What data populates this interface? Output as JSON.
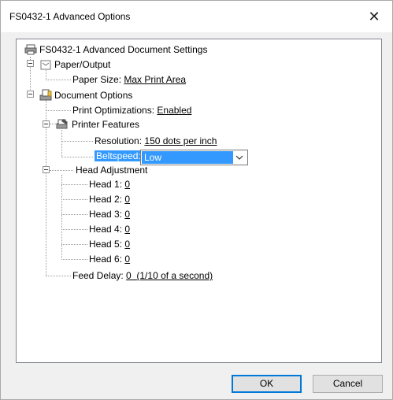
{
  "window": {
    "title": "FS0432-1 Advanced Options",
    "close_glyph": "✕"
  },
  "tree": {
    "root": "FS0432-1 Advanced Document Settings",
    "paper_output": "Paper/Output",
    "paper_size_label": "Paper Size:",
    "paper_size_value": "Max Print Area",
    "document_options": "Document Options",
    "print_opt_label": "Print Optimizations:",
    "print_opt_value": "Enabled",
    "printer_features": "Printer Features",
    "resolution_label": "Resolution:",
    "resolution_value": "150 dots per inch",
    "beltspeed_label": "Beltspeed:",
    "beltspeed_value": "Low",
    "head_adjustment": "Head Adjustment",
    "heads": [
      {
        "label": "Head 1:",
        "value": "0"
      },
      {
        "label": "Head 2:",
        "value": "0"
      },
      {
        "label": "Head 3:",
        "value": "0"
      },
      {
        "label": "Head 4:",
        "value": "0"
      },
      {
        "label": "Head 5:",
        "value": "0"
      },
      {
        "label": "Head 6:",
        "value": "0"
      }
    ],
    "feed_delay_label": "Feed Delay:",
    "feed_delay_value": "0  (1/10 of a second)"
  },
  "buttons": {
    "ok": "OK",
    "cancel": "Cancel"
  },
  "icons": {
    "root": "printer-icon",
    "paper": "paper-icon",
    "document": "document-options-icon",
    "features": "printer-features-icon"
  }
}
